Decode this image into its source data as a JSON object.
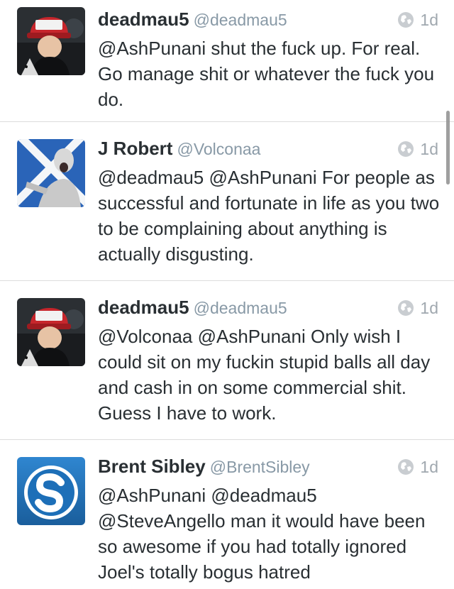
{
  "tweets": [
    {
      "name": "deadmau5",
      "handle": "@deadmau5",
      "age": "1d",
      "text": "@AshPunani shut the fuck up. For real. Go manage shit or whatever the fuck you do.",
      "avatar": "deadmau5-avatar"
    },
    {
      "name": "J Robert",
      "handle": "@Volconaa",
      "age": "1d",
      "text": "@deadmau5 @AshPunani For people as successful and fortunate in life as you two to be complaining about anything is actually disgusting.",
      "avatar": "volconaa-avatar"
    },
    {
      "name": "deadmau5",
      "handle": "@deadmau5",
      "age": "1d",
      "text": "@Volconaa @AshPunani Only wish I could sit on my fuckin stupid balls all day and cash in on some commercial shit. Guess I have to work.",
      "avatar": "deadmau5-avatar"
    },
    {
      "name": "Brent Sibley",
      "handle": "@BrentSibley",
      "age": "1d",
      "text": "@AshPunani @deadmau5 @SteveAngello man it would have been so awesome if you had totally ignored Joel's totally bogus hatred",
      "avatar": "brentsibley-avatar"
    }
  ],
  "icons": {
    "visibility": "globe-icon"
  },
  "colors": {
    "name": "#292f33",
    "handle": "#8899a6",
    "age": "#a0a8af",
    "divider": "#dcdcdc",
    "s_logo_blue": "#1d6fb8"
  }
}
